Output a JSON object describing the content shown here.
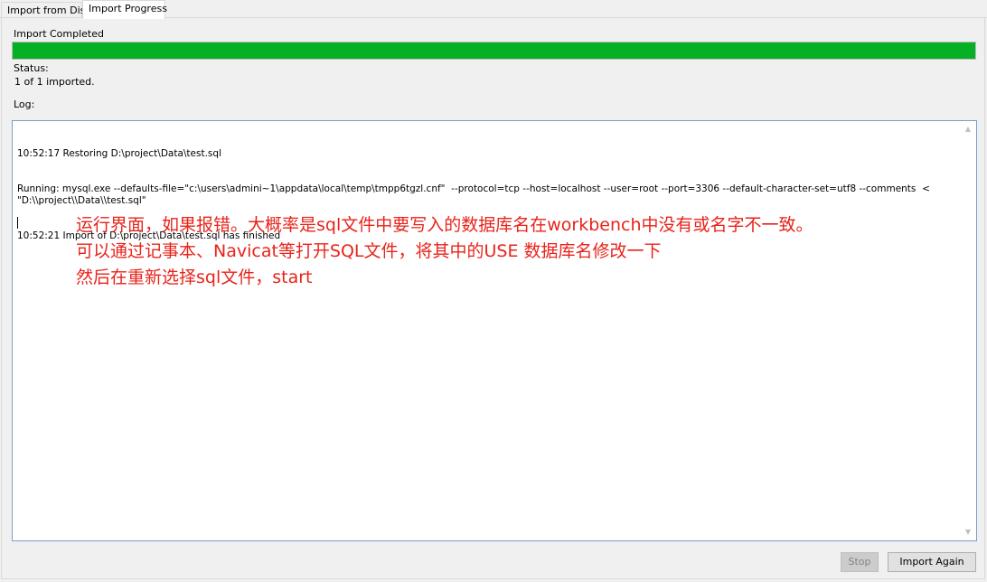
{
  "tabs": [
    {
      "label": "Import from Disk",
      "active": false
    },
    {
      "label": "Import Progress",
      "active": true
    }
  ],
  "progress": {
    "title": "Import Completed",
    "value_percent": 100,
    "fill_color": "#06b025"
  },
  "status": {
    "label": "Status:",
    "text": "1 of 1 imported."
  },
  "log": {
    "label": "Log:",
    "lines": [
      "10:52:17 Restoring D:\\project\\Data\\test.sql",
      "Running: mysql.exe --defaults-file=\"c:\\users\\admini~1\\appdata\\local\\temp\\tmpp6tgzl.cnf\"  --protocol=tcp --host=localhost --user=root --port=3306 --default-character-set=utf8 --comments  < \"D:\\\\project\\\\Data\\\\test.sql\"",
      "10:52:21 Import of D:\\project\\Data\\test.sql has finished"
    ]
  },
  "annotation": {
    "color": "#e8231a",
    "lines": [
      "运行界面，如果报错。大概率是sql文件中要写入的数据库名在workbench中没有或名字不一致。",
      "可以通过记事本、Navicat等打开SQL文件，将其中的USE 数据库名修改一下",
      "然后在重新选择sql文件，start"
    ]
  },
  "buttons": {
    "stop": {
      "label": "Stop",
      "enabled": false
    },
    "import_again": {
      "label": "Import Again",
      "enabled": true
    }
  },
  "icons": {
    "scroll_up": "chevron-up-icon",
    "scroll_down": "chevron-down-icon"
  }
}
